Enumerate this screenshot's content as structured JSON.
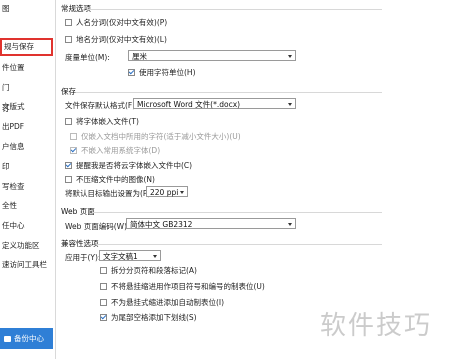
{
  "sidebar": {
    "items": [
      {
        "label": "图"
      },
      {
        "label": "规与保存"
      },
      {
        "label": "件位置"
      },
      {
        "label": "门"
      },
      {
        "label": "订"
      },
      {
        "label": "文版式"
      },
      {
        "label": "出PDF"
      },
      {
        "label": "户信息"
      },
      {
        "label": "印"
      },
      {
        "label": "写检查"
      },
      {
        "label": "全性"
      },
      {
        "label": "任中心"
      },
      {
        "label": "定义功能区"
      },
      {
        "label": "速访问工具栏"
      }
    ],
    "selected_index": 1,
    "backup_button": "备份中心"
  },
  "general": {
    "title": "常规选项",
    "cb_name_grid": "人名分词(仅对中文有效)(P)",
    "cb_place_grid": "地名分词(仅对中文有效)(L)",
    "measure_label": "度量单位(M):",
    "measure_value": "厘米",
    "cb_char_unit": "使用字符单位(H)"
  },
  "save": {
    "title": "保存",
    "format_label": "文件保存默认格式(F):",
    "format_value": "Microsoft Word 文件(*.docx)",
    "cb_embed_fonts": "将字体嵌入文件(T)",
    "cb_only_used": "仅嵌入文档中所用的字符(适于减小文件大小)(U)",
    "cb_no_common": "不嵌入常用系统字体(D)",
    "cb_remind_cloud": "提醒我是否将云字体嵌入文件中(C)",
    "cb_no_compress": "不压缩文件中的图像(N)",
    "ppi_label": "将默认目标输出设置为(P):",
    "ppi_value": "220 ppi"
  },
  "web": {
    "title": "Web 页面",
    "encoding_label": "Web 页面编码(W):",
    "encoding_value": "简体中文 GB2312"
  },
  "compat": {
    "title": "兼容性选项",
    "apply_label": "应用于(Y):",
    "apply_value": "文字文稿1",
    "cb_split_page": "拆分分页符和段落标记(A)",
    "cb_no_tab_after_num": "不将悬挂缩进用作项目符号和编号的制表位(U)",
    "cb_no_auto_tab": "不为悬挂式缩进添加自动制表位(I)",
    "cb_underline_trailing": "为尾部空格添加下划线(S)"
  },
  "watermark": "软件技巧"
}
